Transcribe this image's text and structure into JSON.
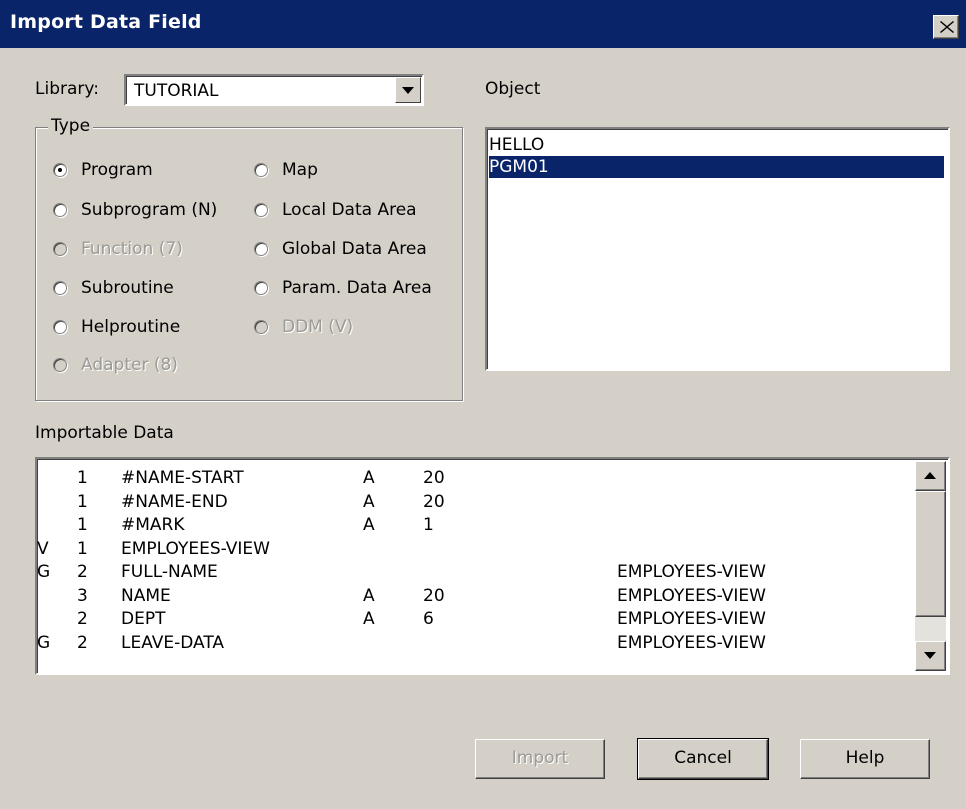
{
  "window": {
    "title": "Import Data Field"
  },
  "library": {
    "label": "Library:",
    "value": "TUTORIAL"
  },
  "type_group": {
    "legend": "Type",
    "options": [
      {
        "label": "Program",
        "checked": true,
        "disabled": false
      },
      {
        "label": "Subprogram (N)",
        "checked": false,
        "disabled": false
      },
      {
        "label": "Function (7)",
        "checked": false,
        "disabled": true
      },
      {
        "label": "Subroutine",
        "checked": false,
        "disabled": false
      },
      {
        "label": "Helproutine",
        "checked": false,
        "disabled": false
      },
      {
        "label": "Adapter (8)",
        "checked": false,
        "disabled": true
      },
      {
        "label": "Map",
        "checked": false,
        "disabled": false
      },
      {
        "label": "Local Data Area",
        "checked": false,
        "disabled": false
      },
      {
        "label": "Global Data Area",
        "checked": false,
        "disabled": false
      },
      {
        "label": "Param. Data Area",
        "checked": false,
        "disabled": false
      },
      {
        "label": "DDM (V)",
        "checked": false,
        "disabled": true
      }
    ]
  },
  "object": {
    "label": "Object",
    "items": [
      {
        "text": "HELLO",
        "selected": false
      },
      {
        "text": "PGM01",
        "selected": true
      }
    ]
  },
  "importable": {
    "label": "Importable Data",
    "rows": [
      {
        "flag": "",
        "level": "1",
        "name": "#NAME-START",
        "format": "A",
        "length": "20",
        "view": ""
      },
      {
        "flag": "",
        "level": "1",
        "name": "#NAME-END",
        "format": "A",
        "length": "20",
        "view": ""
      },
      {
        "flag": "",
        "level": "1",
        "name": "#MARK",
        "format": "A",
        "length": "1",
        "view": ""
      },
      {
        "flag": "V",
        "level": "1",
        "name": "EMPLOYEES-VIEW",
        "format": "",
        "length": "",
        "view": ""
      },
      {
        "flag": "G",
        "level": "2",
        "name": "FULL-NAME",
        "format": "",
        "length": "",
        "view": "EMPLOYEES-VIEW"
      },
      {
        "flag": "",
        "level": "3",
        "name": "NAME",
        "format": "A",
        "length": "20",
        "view": "EMPLOYEES-VIEW"
      },
      {
        "flag": "",
        "level": "2",
        "name": "DEPT",
        "format": "A",
        "length": "6",
        "view": "EMPLOYEES-VIEW"
      },
      {
        "flag": "G",
        "level": "2",
        "name": "LEAVE-DATA",
        "format": "",
        "length": "",
        "view": "EMPLOYEES-VIEW"
      }
    ]
  },
  "buttons": {
    "import": "Import",
    "cancel": "Cancel",
    "help": "Help"
  },
  "colors": {
    "title_bar": "#0a246a",
    "dialog_bg": "#d4d0c8",
    "selection": "#0a246a"
  }
}
